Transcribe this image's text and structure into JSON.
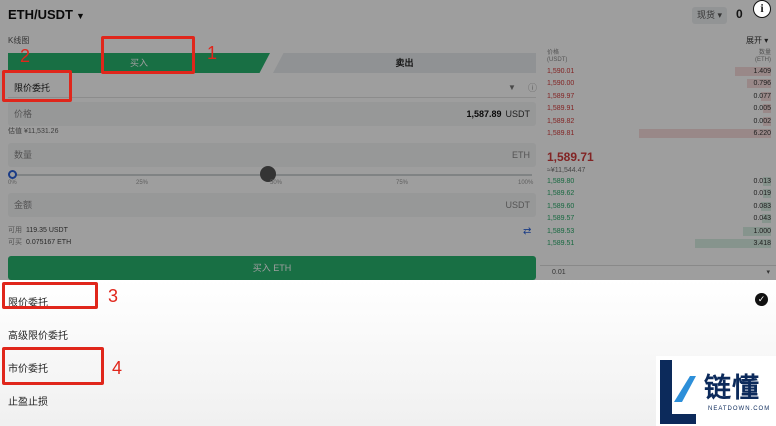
{
  "header": {
    "pair": "ETH/USDT",
    "market_type": "现货",
    "right_text": "0",
    "info_glyph": "i",
    "kline_label": "K线图",
    "expand_label": "展开"
  },
  "trade_tabs": {
    "buy": "买入",
    "sell": "卖出"
  },
  "order_type_selected": "限价委托",
  "price_field": {
    "label": "价格",
    "value": "1,587.89",
    "unit": "USDT",
    "estimate": "估值 ¥11,531.26"
  },
  "qty_field": {
    "label": "数量",
    "unit": "ETH"
  },
  "slider": {
    "ticks": [
      "0%",
      "25%",
      "50%",
      "75%",
      "100%"
    ],
    "value_fraction": 0.5
  },
  "amount_field": {
    "label": "金额",
    "unit": "USDT"
  },
  "available": [
    {
      "label": "可用",
      "value": "119.35 USDT"
    },
    {
      "label": "可买",
      "value": "0.075167 ETH"
    }
  ],
  "buy_button": "买入 ETH",
  "order_book": {
    "price_header": "价格",
    "price_unit": "(USDT)",
    "qty_header": "数量",
    "qty_unit": "(ETH)",
    "asks": [
      {
        "price": "1,590.01",
        "qty": "1.409"
      },
      {
        "price": "1,590.00",
        "qty": "0.796"
      },
      {
        "price": "1,589.97",
        "qty": "0.077"
      },
      {
        "price": "1,589.91",
        "qty": "0.005"
      },
      {
        "price": "1,589.82",
        "qty": "0.002"
      },
      {
        "price": "1,589.81",
        "qty": "6.220"
      }
    ],
    "last_price": "1,589.71",
    "last_price_cny": "≈¥11,544.47",
    "bids": [
      {
        "price": "1,589.80",
        "qty": "0.013"
      },
      {
        "price": "1,589.62",
        "qty": "0.019"
      },
      {
        "price": "1,589.60",
        "qty": "0.083"
      },
      {
        "price": "1,589.57",
        "qty": "0.043"
      },
      {
        "price": "1,589.53",
        "qty": "1.000"
      },
      {
        "price": "1,589.51",
        "qty": "3.418"
      }
    ],
    "precision": "0.01"
  },
  "order_type_menu": [
    "限价委托",
    "高级限价委托",
    "市价委托",
    "止盈止损"
  ],
  "annotations": [
    "1",
    "2",
    "3",
    "4"
  ],
  "watermark": {
    "brand": "链懂",
    "domain": "NEATDOWN.COM"
  },
  "colors": {
    "buy_green": "#27b36f",
    "ask_red": "#d23b3b",
    "annotation_red": "#e0261b",
    "brand_navy": "#0c2a5b"
  }
}
